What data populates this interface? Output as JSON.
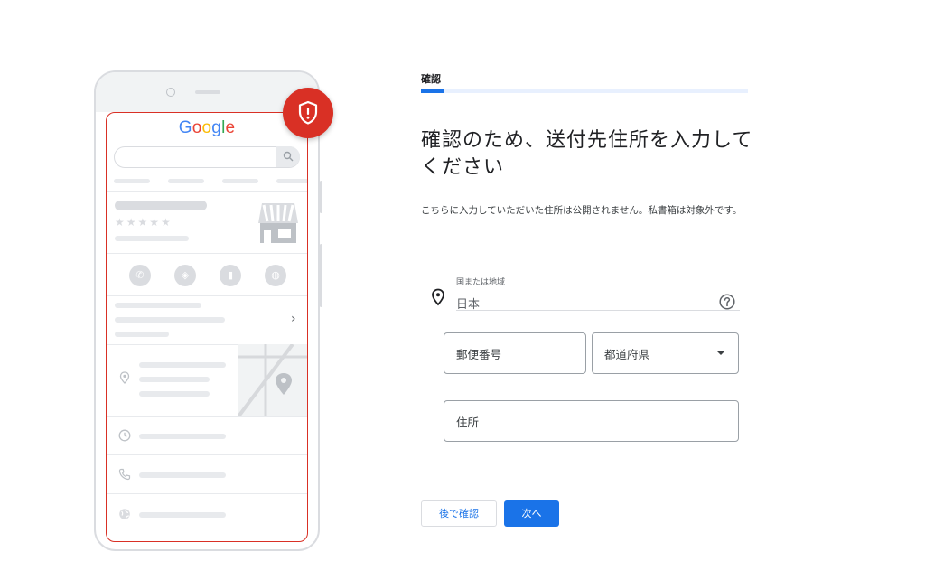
{
  "illustration": {
    "logo_text": "Google",
    "logo_colors": [
      "#4285F4",
      "#EA4335",
      "#FBBC05",
      "#4285F4",
      "#34A853",
      "#EA4335"
    ],
    "stars": "★★★★★",
    "accent_color": "#d93025"
  },
  "form": {
    "step_label": "確認",
    "heading": "確認のため、送付先住所を入力してください",
    "description": "こちらに入力していただいた住所は公開されません。私書箱は対象外です。",
    "country_label": "国または地域",
    "country_value": "日本",
    "postal_placeholder": "郵便番号",
    "prefecture_placeholder": "都道府県",
    "address_placeholder": "住所",
    "progress_fraction": 0.07
  },
  "buttons": {
    "later_label": "後で確認",
    "next_label": "次へ"
  },
  "colors": {
    "primary": "#1a73e8",
    "danger": "#d93025"
  }
}
